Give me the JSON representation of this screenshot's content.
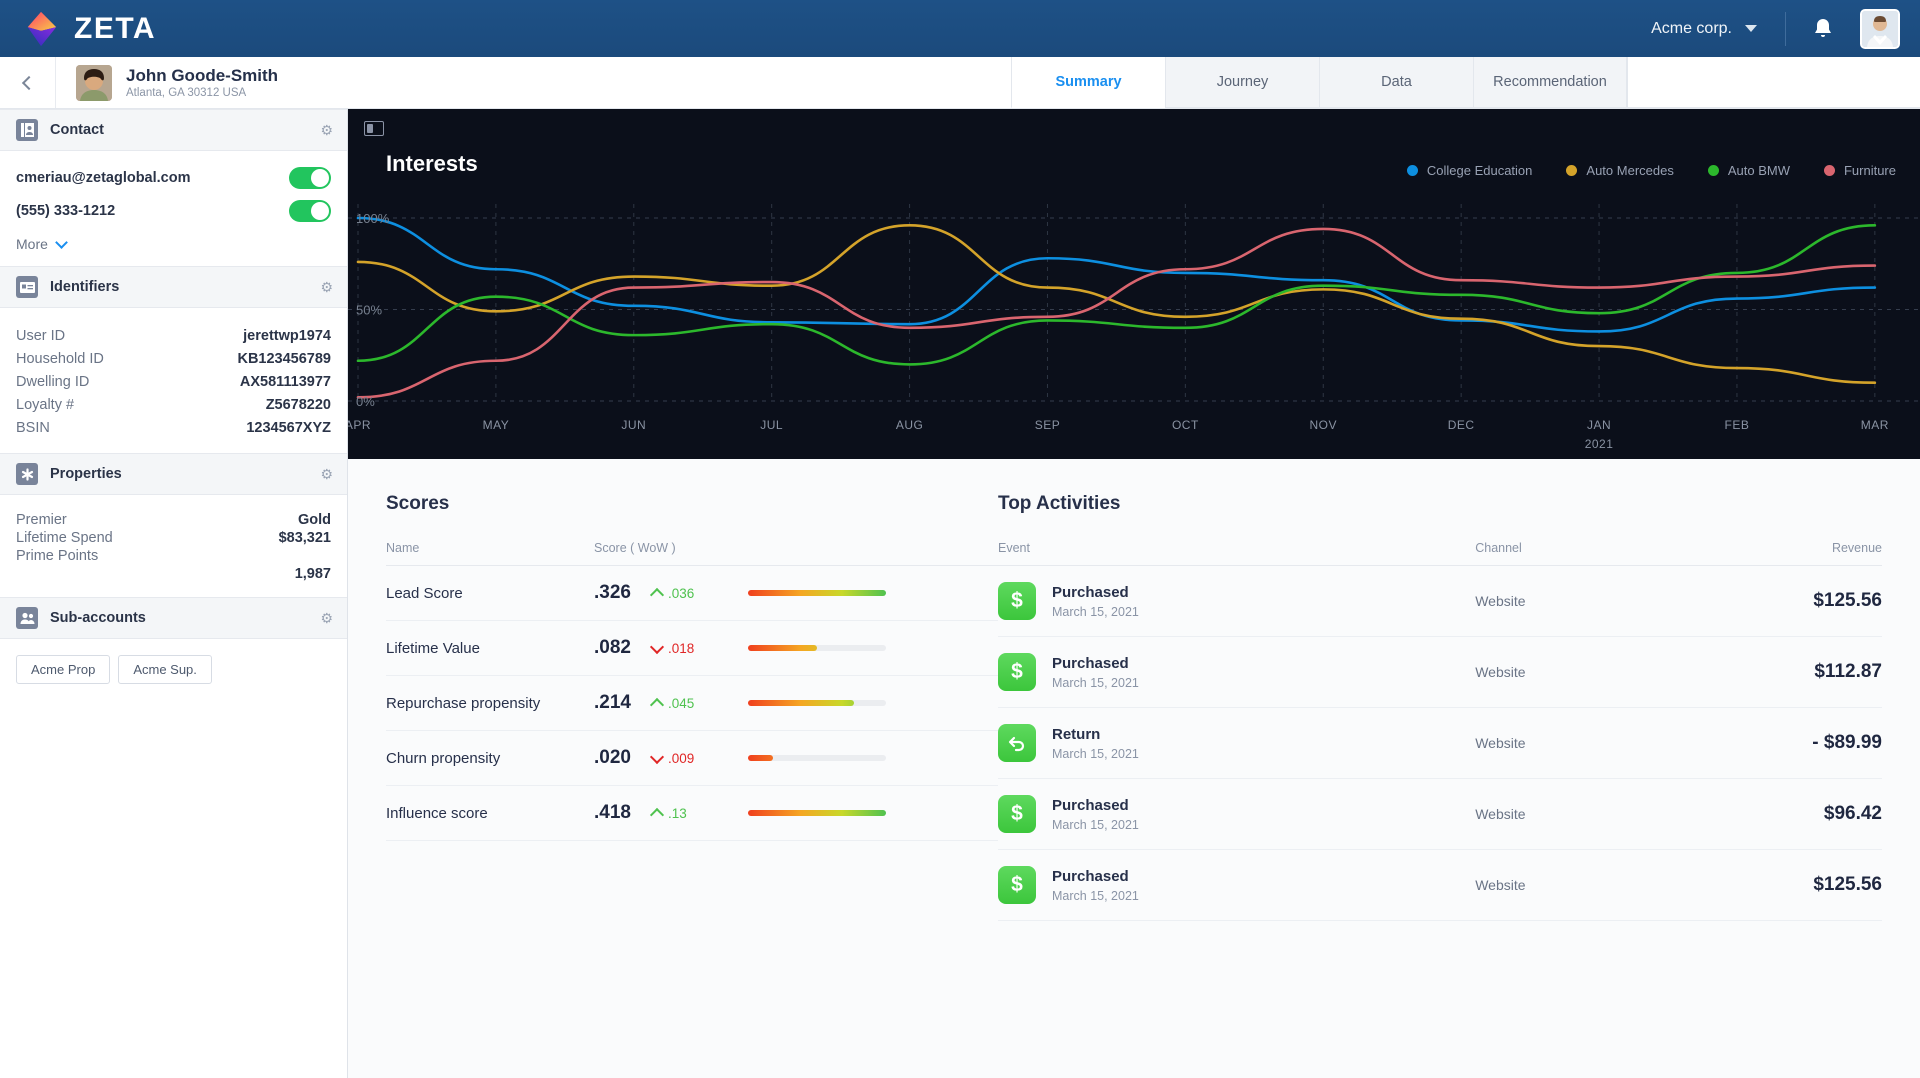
{
  "topbar": {
    "brand": "ZETA",
    "org": "Acme corp.",
    "icons": {
      "bell": "notification-bell",
      "avatar": "user-avatar"
    }
  },
  "subheader": {
    "person_name": "John Goode-Smith",
    "person_location": "Atlanta, GA 30312 USA",
    "tabs": [
      {
        "label": "Summary",
        "active": true
      },
      {
        "label": "Journey",
        "active": false
      },
      {
        "label": "Data",
        "active": false
      },
      {
        "label": "Recommendation",
        "active": false
      }
    ]
  },
  "sidebar": {
    "contact": {
      "title": "Contact",
      "email": "cmeriau@zetaglobal.com",
      "phone": "(555) 333-1212",
      "email_toggle": "on",
      "phone_toggle": "on",
      "more_label": "More"
    },
    "identifiers": {
      "title": "Identifiers",
      "rows": [
        {
          "key": "User ID",
          "value": "jerettwp1974"
        },
        {
          "key": "Household ID",
          "value": "KB123456789"
        },
        {
          "key": "Dwelling ID",
          "value": "AX581113977"
        },
        {
          "key": "Loyalty #",
          "value": "Z5678220"
        },
        {
          "key": "BSIN",
          "value": "1234567XYZ"
        }
      ]
    },
    "properties": {
      "title": "Properties",
      "rows": [
        {
          "key": "Premier",
          "value": "Gold"
        },
        {
          "key": "Lifetime Spend",
          "value": "$83,321"
        },
        {
          "key": "Prime Points",
          "value": "1,987"
        }
      ]
    },
    "subaccounts": {
      "title": "Sub-accounts",
      "chips": [
        "Acme Prop",
        "Acme Sup."
      ]
    }
  },
  "chart_data": {
    "type": "line",
    "title": "Interests",
    "xlabel": "",
    "ylabel": "",
    "ylim": [
      0,
      100
    ],
    "ytick_labels": [
      "0%",
      "50%",
      "100%"
    ],
    "yticks": [
      0,
      50,
      100
    ],
    "grid": true,
    "legend_position": "top-right",
    "x": [
      "APR",
      "MAY",
      "JUN",
      "JUL",
      "AUG",
      "SEP",
      "OCT",
      "NOV",
      "DEC",
      "JAN",
      "FEB",
      "MAR"
    ],
    "x_sub_labels": {
      "JAN": "2021"
    },
    "series": [
      {
        "name": "College Education",
        "color": "#0d8fe0",
        "values": [
          100,
          72,
          52,
          43,
          42,
          78,
          70,
          66,
          44,
          38,
          56,
          62
        ]
      },
      {
        "name": "Auto Mercedes",
        "color": "#d4a32a",
        "values": [
          76,
          49,
          68,
          63,
          96,
          62,
          46,
          61,
          45,
          30,
          18,
          10
        ]
      },
      {
        "name": "Auto BMW",
        "color": "#2cb82c",
        "values": [
          22,
          57,
          36,
          42,
          20,
          44,
          40,
          63,
          58,
          48,
          70,
          96
        ]
      },
      {
        "name": "Furniture",
        "color": "#d9656f",
        "values": [
          2,
          22,
          62,
          65,
          40,
          46,
          72,
          94,
          66,
          62,
          68,
          74
        ]
      }
    ]
  },
  "scores": {
    "title": "Scores",
    "columns": [
      "Name",
      "Score ( WoW )"
    ],
    "rows": [
      {
        "name": "Lead Score",
        "value": ".326",
        "delta": ".036",
        "dir": "up",
        "bar": 100
      },
      {
        "name": "Lifetime Value",
        "value": ".082",
        "delta": ".018",
        "dir": "down",
        "bar": 50
      },
      {
        "name": "Repurchase propensity",
        "value": ".214",
        "delta": ".045",
        "dir": "up",
        "bar": 77
      },
      {
        "name": "Churn propensity",
        "value": ".020",
        "delta": ".009",
        "dir": "down",
        "bar": 18
      },
      {
        "name": "Influence score",
        "value": ".418",
        "delta": ".13",
        "dir": "up",
        "bar": 100
      }
    ]
  },
  "activities": {
    "title": "Top Activities",
    "columns": [
      "Event",
      "Channel",
      "Revenue"
    ],
    "rows": [
      {
        "icon": "dollar-icon",
        "name": "Purchased",
        "date": "March 15, 2021",
        "channel": "Website",
        "revenue": "$125.56"
      },
      {
        "icon": "dollar-icon",
        "name": "Purchased",
        "date": "March 15, 2021",
        "channel": "Website",
        "revenue": "$112.87"
      },
      {
        "icon": "return-icon",
        "name": "Return",
        "date": "March 15, 2021",
        "channel": "Website",
        "revenue": "- $89.99"
      },
      {
        "icon": "dollar-icon",
        "name": "Purchased",
        "date": "March 15, 2021",
        "channel": "Website",
        "revenue": "$96.42"
      },
      {
        "icon": "dollar-icon",
        "name": "Purchased",
        "date": "March 15, 2021",
        "channel": "Website",
        "revenue": "$125.56"
      }
    ]
  },
  "colors": {
    "brand_bar": "#1b4a7c",
    "accent": "#1a8ff0",
    "chart_bg": "#0b0f1a",
    "toggle_on": "#22c55e",
    "up": "#4fc24f",
    "down": "#e02626"
  }
}
